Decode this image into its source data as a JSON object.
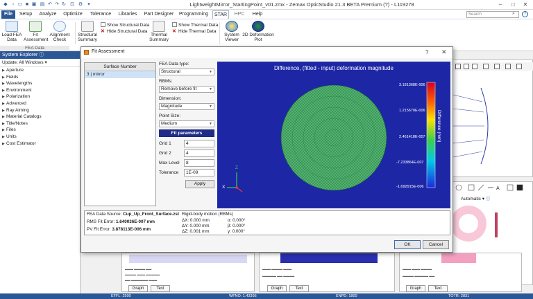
{
  "app": {
    "title": "LightweightMirror_StartingPoint_v01.zmx - Zemax OpticStudio 21.3  BETA  Premium (?) - L119278"
  },
  "menu": {
    "items": [
      "File",
      "Setup",
      "Analyze",
      "Optimize",
      "Tolerance",
      "Libraries",
      "Part Designer",
      "Programming",
      "STAR",
      "HPC",
      "Help"
    ],
    "search_placeholder": "Search"
  },
  "ribbon": {
    "load_fea": "Load FEA Data",
    "fit_assessment": "Fit Assessment",
    "alignment_check": "Alignment Check",
    "structural_summary": "Structural Summary",
    "show_structural": "Show Structural Data",
    "hide_structural": "Hide Structural Data",
    "thermal_summary": "Thermal Summary",
    "show_thermal": "Show Thermal Data",
    "hide_thermal": "Hide Thermal Data",
    "system_viewer": "System Viewer",
    "deformation_plot": "2D Deformation Plot",
    "fea_group": "FEA Data"
  },
  "system_explorer": {
    "title": "System Explorer",
    "update": "Update: All Windows",
    "items": [
      "Aperture",
      "Fields",
      "Wavelengths",
      "Environment",
      "Polarization",
      "Advanced",
      "Ray Aiming",
      "Material Catalogs",
      "Title/Notes",
      "Files",
      "Units",
      "Cost Estimator"
    ]
  },
  "dialog": {
    "title": "Fit Assessment",
    "surface_header": "Surface Number",
    "surface_row": "3 | mirror",
    "fea_type_label": "FEA Data type:",
    "fea_type_value": "Structural",
    "rbms_label": "RBMs:",
    "rbms_value": "Remove before fit",
    "dimension_label": "Dimension:",
    "dimension_value": "Magnitude",
    "point_size_label": "Point Size:",
    "point_size_value": "Medium",
    "fit_params": "Fit parameters",
    "grid1_label": "Grid 1",
    "grid1_value": "4",
    "grid2_label": "Grid 2",
    "grid2_value": "4",
    "maxlevel_label": "Max Level",
    "maxlevel_value": "8",
    "tolerance_label": "Tolerance",
    "tolerance_value": "1E-09",
    "apply": "Apply",
    "plot_title": "Difference, (fitted - input) deformation magnitude",
    "colorbar": [
      "3.181368E-006",
      "1.215670E-006",
      "2.461418E-007",
      "-7.233864E-007",
      "-1.692915E-006"
    ],
    "colorbar_axis": "Difference (mm)",
    "axis_x": "X",
    "axis_z": "Z",
    "fea_source_label": "FEA Data Source:",
    "fea_source_value": "Cup_Up_Front_Surface.zst",
    "rms_label": "RMS Fit Error:",
    "rms_value": "1.640036E-007 mm",
    "pv_label": "PV Fit Error:",
    "pv_value": "3.878113E-006 mm",
    "rbm_title": "Rigid-body motion (RBMs)",
    "dx": "ΔX: 0.000 mm",
    "dy": "ΔY: 0.000 mm",
    "dz": "ΔZ: 0.001 mm",
    "alpha": "α: 0.000°",
    "beta": "β: 0.000°",
    "gamma": "γ: 0.000°",
    "ok": "OK",
    "cancel": "Cancel"
  },
  "background": {
    "automatic": "Automatic",
    "graph_tab": "Graph",
    "text_tab": "Text"
  },
  "status": {
    "effl": "EFFL: 2500",
    "wfno": "WFNO: 1.43395",
    "enpd": "ENPD: 1800",
    "totr": "TOTR: 2831"
  },
  "colors": {
    "accent": "#2b5797",
    "plot_bg": "#1d27a6",
    "fit_params_bg": "#1f2d86",
    "mesh": "#3a9a5a"
  }
}
